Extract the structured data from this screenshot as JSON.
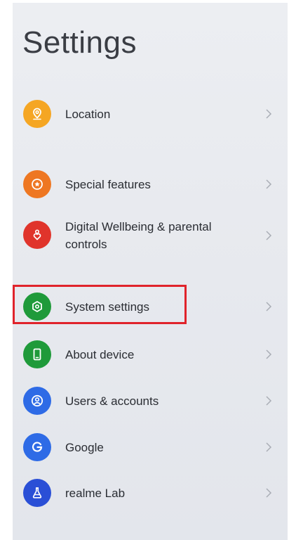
{
  "title": "Settings",
  "items": [
    {
      "label": "Location",
      "icon": "location-pin-icon",
      "color": "#f5a623"
    },
    {
      "label": "Special features",
      "icon": "star-badge-icon",
      "color": "#ee7722"
    },
    {
      "label": "Digital Wellbeing & parental controls",
      "icon": "heart-person-icon",
      "color": "#e0342b"
    },
    {
      "label": "System settings",
      "icon": "hexagon-gear-icon",
      "color": "#1f9a3a"
    },
    {
      "label": "About device",
      "icon": "phone-icon",
      "color": "#1f9a3a"
    },
    {
      "label": "Users & accounts",
      "icon": "user-circle-icon",
      "color": "#2e6be6"
    },
    {
      "label": "Google",
      "icon": "google-g-icon",
      "color": "#2e6be6"
    },
    {
      "label": "realme Lab",
      "icon": "flask-icon",
      "color": "#2a4fd6"
    }
  ],
  "highlight_color": "#e0232b"
}
